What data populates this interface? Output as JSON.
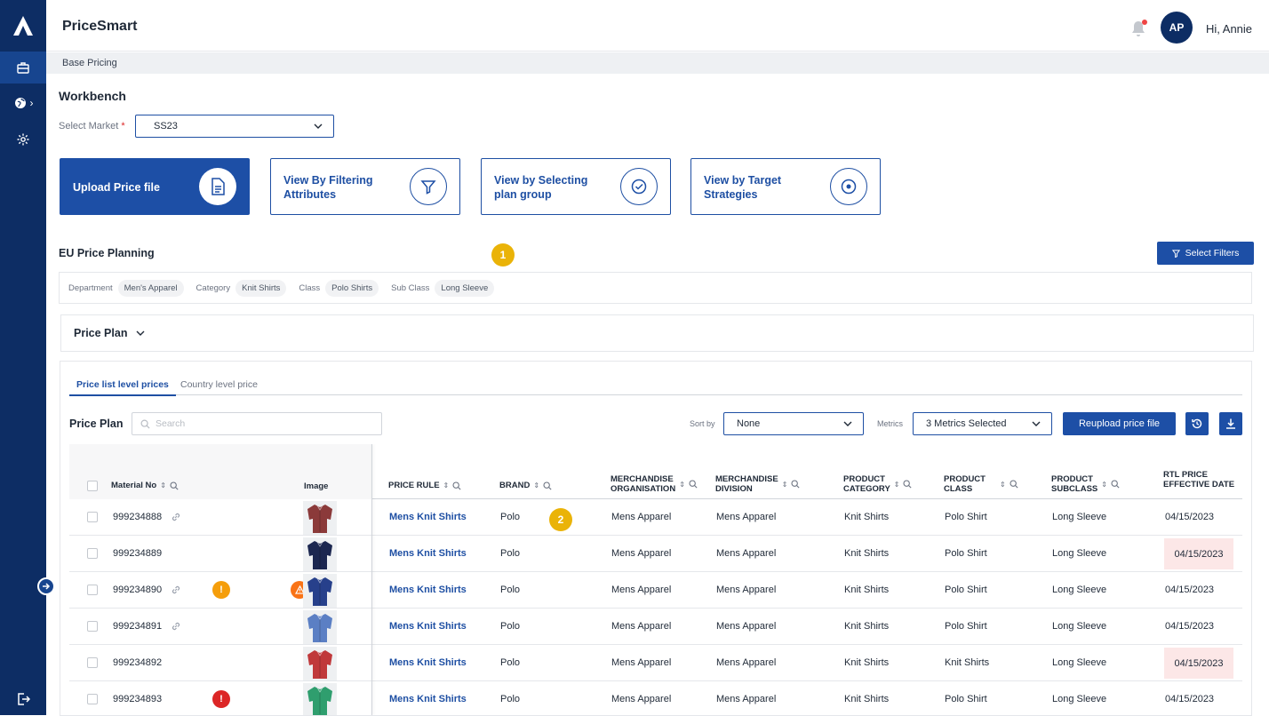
{
  "app": {
    "title": "PriceSmart",
    "greeting": "Hi, Annie",
    "avatar_initials": "AP"
  },
  "breadcrumb": "Base Pricing",
  "page_title": "Workbench",
  "market": {
    "label": "Select Market",
    "required_mark": "*",
    "value": "SS23"
  },
  "cards": [
    {
      "label": "Upload Price file",
      "icon": "document-icon"
    },
    {
      "label": "View By Filtering Attributes",
      "icon": "filter-icon"
    },
    {
      "label": "View by Selecting plan group",
      "icon": "check-circle-icon"
    },
    {
      "label": "View by Target Strategies",
      "icon": "target-icon"
    }
  ],
  "section_title": "EU Price Planning",
  "step_badges": [
    "1",
    "2"
  ],
  "select_filters_label": "Select Filters",
  "filters": [
    {
      "label": "Department",
      "value": "Men's Apparel"
    },
    {
      "label": "Category",
      "value": "Knit Shirts"
    },
    {
      "label": "Class",
      "value": "Polo Shirts"
    },
    {
      "label": "Sub Class",
      "value": "Long Sleeve"
    }
  ],
  "price_plan_collapse": "Price Plan",
  "tabs": {
    "active": "Price list level prices",
    "inactive": "Country level price"
  },
  "toolbar": {
    "label": "Price Plan",
    "search_placeholder": "Search",
    "sort_label": "Sort by",
    "sort_value": "None",
    "metrics_label": "Metrics",
    "metrics_value": "3 Metrics Selected",
    "reupload_label": "Reupload price file"
  },
  "table": {
    "headers": {
      "material": "Material No",
      "image": "Image",
      "price_rule": "PRICE RULE",
      "brand": "BRAND",
      "merch_org": [
        "MERCHANDISE",
        "ORGANISATION"
      ],
      "merch_div": [
        "MERCHANDISE",
        "DIVISION"
      ],
      "prod_cat": [
        "PRODUCT",
        "CATEGORY"
      ],
      "prod_class": [
        "PRODUCT",
        "CLASS"
      ],
      "prod_sub": [
        "PRODUCT",
        "SUBCLASS"
      ],
      "rtl": [
        "RTL PRICE",
        "EFFECTIVE DATE"
      ]
    },
    "rows": [
      {
        "material": "999234888",
        "link": true,
        "alerts": [],
        "price_rule": "Mens Knit Shirts",
        "brand": "Polo",
        "org": "Mens Apparel",
        "div": "Mens Apparel",
        "cat": "Knit Shirts",
        "cls": "Polo Shirt",
        "sub": "Long Sleeve",
        "date": "04/15/2023",
        "date_flag": false,
        "shirt_color": "#8b3a3a"
      },
      {
        "material": "999234889",
        "link": false,
        "alerts": [],
        "price_rule": "Mens Knit Shirts",
        "brand": "Polo",
        "org": "Mens Apparel",
        "div": "Mens Apparel",
        "cat": "Knit Shirts",
        "cls": "Polo Shirt",
        "sub": "Long Sleeve",
        "date": "04/15/2023",
        "date_flag": true,
        "shirt_color": "#1c2750"
      },
      {
        "material": "999234890",
        "link": true,
        "alerts": [
          "!",
          "warning"
        ],
        "price_rule": "Mens Knit Shirts",
        "brand": "Polo",
        "org": "Mens Apparel",
        "div": "Mens Apparel",
        "cat": "Knit Shirts",
        "cls": "Polo Shirt",
        "sub": "Long Sleeve",
        "date": "04/15/2023",
        "date_flag": false,
        "shirt_color": "#27408b"
      },
      {
        "material": "999234891",
        "link": true,
        "alerts": [],
        "price_rule": "Mens Knit Shirts",
        "brand": "Polo",
        "org": "Mens Apparel",
        "div": "Mens Apparel",
        "cat": "Knit Shirts",
        "cls": "Polo Shirt",
        "sub": "Long Sleeve",
        "date": "04/15/2023",
        "date_flag": false,
        "shirt_color": "#5b7fc4"
      },
      {
        "material": "999234892",
        "link": false,
        "alerts": [],
        "price_rule": "Mens Knit Shirts",
        "brand": "Polo",
        "org": "Mens Apparel",
        "div": "Mens Apparel",
        "cat": "Knit Shirts",
        "cls": "Knit Shirts",
        "sub": "Long Sleeve",
        "date": "04/15/2023",
        "date_flag": true,
        "shirt_color": "#c0393b"
      },
      {
        "material": "999234893",
        "link": false,
        "alerts": [
          "!"
        ],
        "price_rule": "Mens Knit Shirts",
        "brand": "Polo",
        "org": "Mens Apparel",
        "div": "Mens Apparel",
        "cat": "Knit Shirts",
        "cls": "Polo Shirt",
        "sub": "Long Sleeve",
        "date": "04/15/2023",
        "date_flag": false,
        "shirt_color": "#2f9e6e"
      }
    ]
  },
  "colors": {
    "primary": "#1d4fa6",
    "sidebar": "#0d2d64",
    "badge": "#eab308",
    "alert_red": "#dc2626",
    "alert_orange": "#f59e0b"
  }
}
